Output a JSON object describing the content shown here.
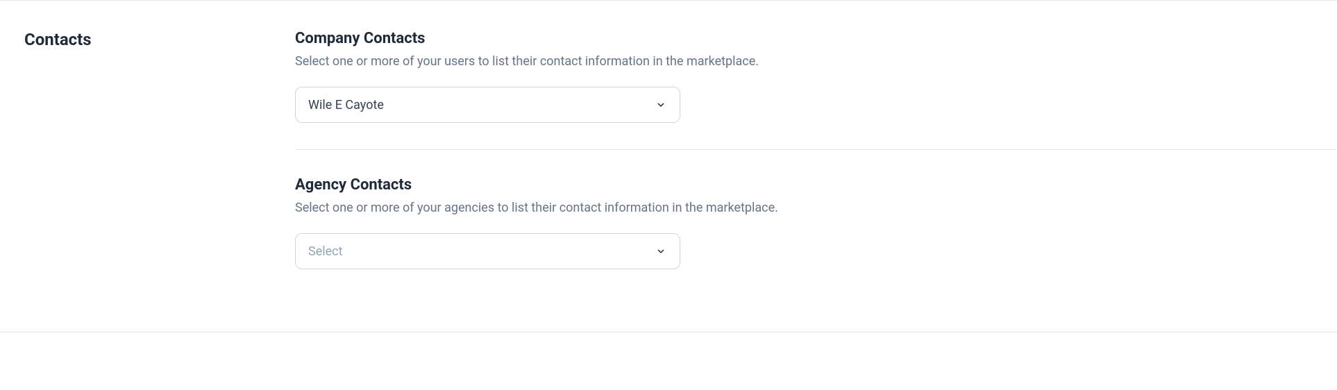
{
  "sidebar": {
    "title": "Contacts"
  },
  "sections": {
    "company": {
      "title": "Company Contacts",
      "description": "Select one or more of your users to list their contact information in the marketplace.",
      "select_value": "Wile E Cayote",
      "select_placeholder": "Select"
    },
    "agency": {
      "title": "Agency Contacts",
      "description": "Select one or more of your agencies to list their contact information in the marketplace.",
      "select_value": "",
      "select_placeholder": "Select"
    }
  }
}
